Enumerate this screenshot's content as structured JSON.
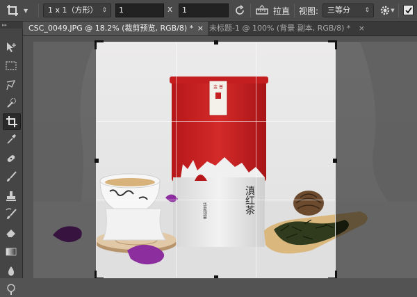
{
  "options_bar": {
    "ratio_preset": "1 x 1（方形）",
    "width_value": "1",
    "height_value": "1",
    "x_label": "x",
    "straighten_label": "拉直",
    "view_label": "视图:",
    "view_option": "三等分"
  },
  "tabs": [
    {
      "label": "CSC_0049.JPG @ 18.2% (裁剪预览, RGB/8) *",
      "active": true
    },
    {
      "label": "未标题-1 @ 100% (背景 副本, RGB/8) *",
      "active": false
    }
  ],
  "tab_close_glyph": "×",
  "tools": [
    "move-icon",
    "marquee-icon",
    "lasso-icon",
    "quick-select-icon",
    "crop-icon",
    "eyedropper-icon",
    "healing-brush-icon",
    "brush-icon",
    "clone-stamp-icon",
    "history-brush-icon",
    "eraser-icon",
    "gradient-icon",
    "blur-icon",
    "dodge-icon"
  ],
  "colors": {
    "accent_red": "#c81e1e",
    "panel": "#4a4a4a",
    "canvas_bg": "#535353"
  },
  "product": {
    "label_top": "金 普",
    "name_vertical": "滇红茶",
    "label_small": "华夏领宴"
  }
}
